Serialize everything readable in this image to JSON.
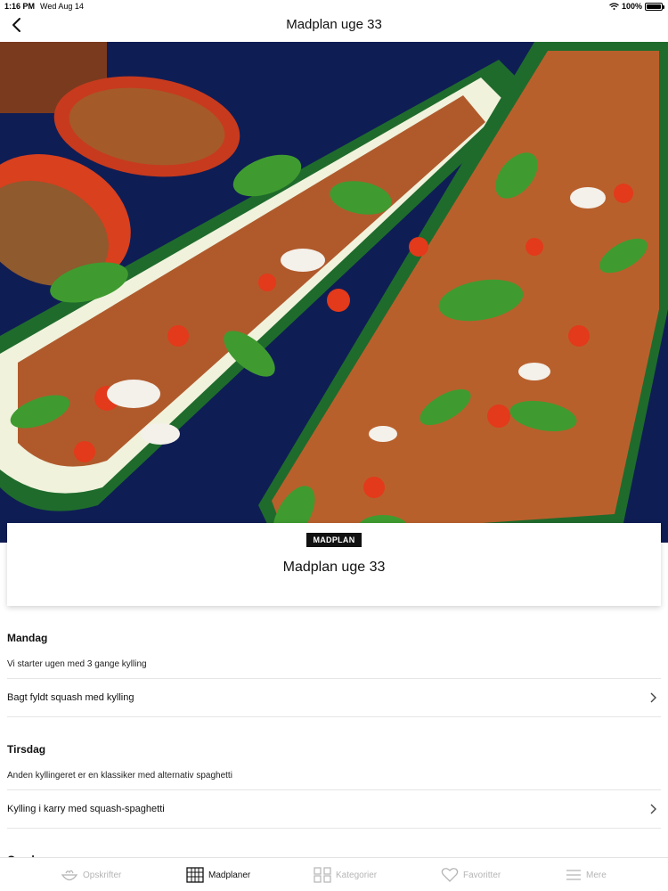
{
  "status": {
    "time": "1:16 PM",
    "date": "Wed Aug 14",
    "battery": "100%"
  },
  "nav": {
    "title": "Madplan uge 33"
  },
  "card": {
    "badge": "MADPLAN",
    "title": "Madplan uge 33"
  },
  "days": [
    {
      "name": "Mandag",
      "intro": "Vi starter ugen med 3 gange kylling",
      "recipe": "Bagt fyldt squash med kylling"
    },
    {
      "name": "Tirsdag",
      "intro": "Anden kyllingeret er en klassiker med alternativ spaghetti",
      "recipe": "Kylling i karry med squash-spaghetti"
    },
    {
      "name": "Onsdag"
    }
  ],
  "tabs": [
    {
      "label": "Opskrifter",
      "icon": "bowl-icon",
      "active": false
    },
    {
      "label": "Madplaner",
      "icon": "calendar-grid-icon",
      "active": true
    },
    {
      "label": "Kategorier",
      "icon": "category-grid-icon",
      "active": false
    },
    {
      "label": "Favoritter",
      "icon": "heart-icon",
      "active": false
    },
    {
      "label": "Mere",
      "icon": "menu-icon",
      "active": false
    }
  ]
}
